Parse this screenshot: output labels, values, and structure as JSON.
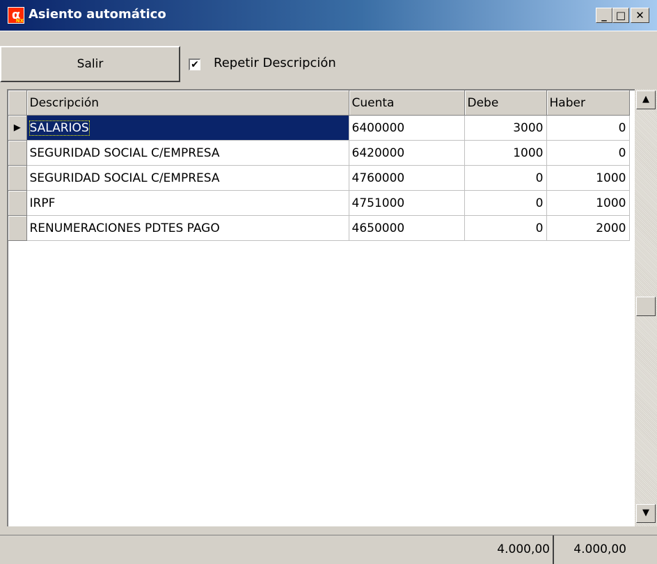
{
  "window": {
    "title": "Asiento automático",
    "minimize_label": "_",
    "maximize_label": "□",
    "close_label": "✕"
  },
  "toolbar": {
    "salir_label": "Salir",
    "repeat_checkbox_label": "Repetir Descripción",
    "repeat_checked": true,
    "check_mark": "✔"
  },
  "grid": {
    "columns": [
      "Descripción",
      "Cuenta",
      "Debe",
      "Haber"
    ],
    "selected_indicator": "▶",
    "rows": [
      {
        "descripcion": "SALARIOS",
        "cuenta": "6400000",
        "debe": "3000",
        "haber": "0"
      },
      {
        "descripcion": "SEGURIDAD SOCIAL C/EMPRESA",
        "cuenta": "6420000",
        "debe": "1000",
        "haber": "0"
      },
      {
        "descripcion": "SEGURIDAD SOCIAL C/EMPRESA",
        "cuenta": "4760000",
        "debe": "0",
        "haber": "1000"
      },
      {
        "descripcion": "IRPF",
        "cuenta": "4751000",
        "debe": "0",
        "haber": "1000"
      },
      {
        "descripcion": "RENUMERACIONES PDTES PAGO",
        "cuenta": "4650000",
        "debe": "0",
        "haber": "2000"
      }
    ]
  },
  "scrollbar": {
    "up_arrow": "▲",
    "down_arrow": "▼"
  },
  "totals": {
    "debe": "4.000,00",
    "haber": "4.000,00"
  },
  "colors": {
    "selection": "#0a246a",
    "titlebar_start": "#0a246a",
    "titlebar_end": "#a6caf0",
    "face": "#d4d0c8"
  }
}
